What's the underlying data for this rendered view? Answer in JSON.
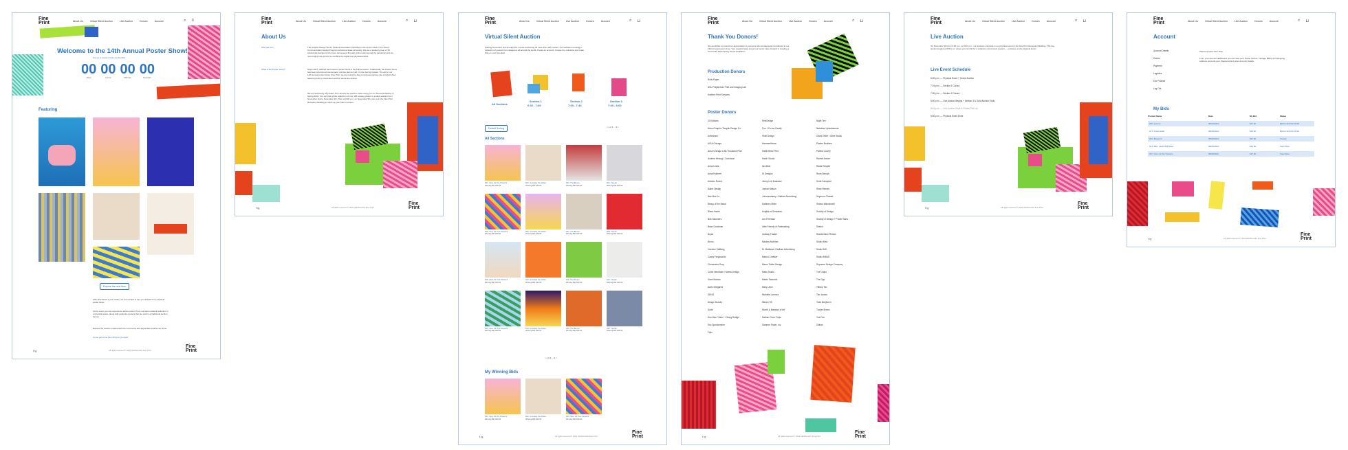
{
  "nav": {
    "logo": "Fine Print",
    "links": [
      "About Us",
      "Virtual Silent Auction",
      "Live Auction",
      "Donors",
      "Account"
    ],
    "search_icon": "search-icon",
    "cart_icon": "cart-icon"
  },
  "home": {
    "title": "Welcome to the 14th Annual Poster Show!",
    "subtitle": "Get up to speed in the Live Auction!",
    "countdown": [
      {
        "n": "00",
        "label": "Days"
      },
      {
        "n": "00",
        "label": "Hours"
      },
      {
        "n": "00",
        "label": "Minutes"
      },
      {
        "n": "00",
        "label": "Seconds"
      }
    ],
    "featuring": "Featuring",
    "explore_btn": "Explore the next item",
    "para1": "After Erie Show a year online, we are excited to see you all back for a physical poster show.",
    "para2": "At the event you can experience all the posters from our talent student collection in a physical space, along with exclusive posters that are sold in a traditional auction format.",
    "para3": "Explore the season curated with the community and appreciate another art show.",
    "cta": "Come get some Fine Print for yourself!"
  },
  "about": {
    "title": "About Us",
    "sidebar": [
      "Who are we?",
      "What is the Poster Show?"
    ],
    "text1": "The Graphic Design Senior Student Association (GDSSA) is the senior class in the Visual Communication Design Program at Arizona State University. We are a student group of 39 passionate designers who have persevered through online learning and the pandemic and are now forging new ground to combine the digital and physical worlds.",
    "text2": "Since 2007, GDSSA has hosted a poster show in the Fall semester. Traditionally, the Poster Show has been a bonus announcement, and we plan to hold it in the Spring instead. The art for our 14th annual poster show, Fine Print, we are trying the best to fold experiences into a hybrid show featuring both a virtual silent auction and a live auction.",
    "text3": "We are auctioning off posters from around the world to raise money for our Senior Exhibition in Spring 2022. You can find all the collection of over 100 unique posters in a silent auction from November 2nd to November 4th. Then at 6:00 p.m. on November 5th, join us in the Fine Print Reception Building to catch up your bids in person.",
    "link": "Fine Print Reception Building"
  },
  "silent": {
    "title": "Virtual Silent Auction",
    "intro": "Starting November 2nd through 4th, we are auctioning off more than 100 posters. Our website is hosting a collection of posters from designers all around the world. Create an account, browse the collection and make bids on your favorites!",
    "sections": [
      {
        "label": "All Sections",
        "time": ""
      },
      {
        "label": "Section 1",
        "time": "6:30 - 7:00"
      },
      {
        "label": "Section 2",
        "time": "7:00 - 7:30"
      },
      {
        "label": "Section 3",
        "time": "7:30 - 8:00"
      }
    ],
    "sort": "Default Sorting",
    "pagination": "< 1 2 3 ... 9 >",
    "all_sections": "All Sections",
    "items": [
      {
        "cap": "001. Give Us Our Flowers",
        "bid": "Winning Bid: $15.00"
      },
      {
        "cap": "002. Consider the Lillies",
        "bid": "Winning Bid: $15.00"
      },
      {
        "cap": "003. The Bonus",
        "bid": "Winning Bid: $15.00"
      },
      {
        "cap": "004. Yamas",
        "bid": "Winning Bid: $15.00"
      },
      {
        "cap": "005. Give Us Your Flowers",
        "bid": "Winning Bid: $15.00"
      },
      {
        "cap": "006. Consider the Lillies",
        "bid": "Winning Bid: $15.00"
      },
      {
        "cap": "007. The Bonus",
        "bid": "Winning Bid: $15.00"
      },
      {
        "cap": "008. Yamas",
        "bid": "Winning Bid: $15.00"
      },
      {
        "cap": "009. Give Us Your Flowers",
        "bid": "Winning Bid: $15.00"
      },
      {
        "cap": "010. Consider the Lillies",
        "bid": "Winning Bid: $15.00"
      },
      {
        "cap": "011. The Bonus",
        "bid": "Winning Bid: $15.00"
      },
      {
        "cap": "012. Yamas",
        "bid": "Winning Bid: $15.00"
      },
      {
        "cap": "013. Give Us Your Flowers",
        "bid": "Winning Bid: $15.00"
      },
      {
        "cap": "014. Consider the Lillies",
        "bid": "Winning Bid: $15.00"
      },
      {
        "cap": "015. The Bonus",
        "bid": "Winning Bid: $15.00"
      },
      {
        "cap": "016. Yamas",
        "bid": "Winning Bid: $15.00"
      }
    ],
    "winning_title": "My Winning Bids",
    "winning": [
      {
        "cap": "001. Give Us Our Flowers",
        "bid": "Winning Bid: $15.00"
      },
      {
        "cap": "002. Consider the Lillies",
        "bid": "Winning Bid: $15.00"
      },
      {
        "cap": "003. Give Us Your Flowers",
        "bid": "Winning Bid: $15.00"
      }
    ]
  },
  "donors": {
    "title": "Thank You Donors!",
    "intro": "We would like to extend our appreciation to everyone who donated and contributed to our 14th annual poster show. Your support helps propel our senior class forward in creating a successful 2022 Spring Senior Exhibition.",
    "production_title": "Production Donors",
    "production": [
      "Rolls Paper",
      "ASU Polytechnic Print and Imaging Lab",
      "Xcellent Print Services"
    ],
    "poster_title": "Poster Donors",
    "col1": [
      "20 Editions",
      "Aaron Draplin / Draplin Design Co.",
      "Adhesions",
      "AIGA Chicago",
      "AIGA Chicago x AB Thousand Plan",
      "Andrew Herzog / Coinvision",
      "Anna Lewis",
      "Anna Hubbert",
      "Antonio Rocha",
      "Baker Design",
      "Bee Mee Jo",
      "Beavy of the Beast",
      "Black Haven",
      "Bob Saunders",
      "Brian Goodman",
      "Bryan",
      "Bruno",
      "Caroline Kallberg",
      "Casey Ferguschild",
      "Chrissindor Drop",
      "Curtis Needham / Needs Design",
      "Dami Marcus",
      "Dave Seriganta",
      "DKNG",
      "Design Donuts",
      "Dude",
      "Don Mac / Sam + Chung Design",
      "Eric Speckemeier",
      "Felix"
    ],
    "col2": [
      "FineDesign",
      "Fun + For an Family",
      "Final Design",
      "Hammerlthrow",
      "Hattie Brew Print",
      "Hatch Studio",
      "Ian Alber",
      "IS Designs",
      "Jenny Lee Illustrator",
      "Jordan Nelson",
      "Juniorsadanny / Nathan Advertising",
      "Kathleen Miller",
      "Knights of Sensation",
      "Lee Freeman",
      "Little Friends of Printmaking",
      "Lindsay Fraster",
      "Mackey Mohrlan",
      "M. Matthews / Nathan Advertising",
      "Marcol Creative",
      "Marco Potter Design",
      "Matin Studio",
      "Martin Saucedo",
      "Mary Lavin",
      "Michelle Lorenza",
      "Miriam Tifl",
      "Month & Mansion of Art",
      "Nathan Cone Prints",
      "Sammer Paper, Inc."
    ],
    "col3": [
      "Night Terr",
      "Nakulbar Upholstereds",
      "Olivia Oliver / Olive Studio",
      "Plaster Brothers",
      "Patrick Curvey",
      "Rachel Archer",
      "Rania Rosplet",
      "Rune Benzyk",
      "Scott Campbell",
      "Sean Reeves",
      "Seymour Chwast",
      "Shawn Wanderdell",
      "Society of Design",
      "Society of Design + Poster Stars",
      "Sketch",
      "Slumbertime Renew",
      "Studio Mira",
      "Studio MD",
      "Studio MBAS",
      "Supreme Design Company",
      "The Outpo",
      "The Opp",
      "Tiffany Tan",
      "Tim Jordan",
      "Todd McQueen",
      "Tucker Brown",
      "Yue Fan",
      "Zhifron"
    ]
  },
  "live": {
    "title": "Live Auction",
    "intro": "On November 5th from 6:30 p.m. to 8:00 p.m., our auctions conclude in our physical event in the Fine Print Reception Building. This live auction begins at 6:00 p.m. where you can bid for a collection of premium posters — exclusive to the physical show!",
    "schedule_title": "Live Event Schedule",
    "schedule": [
      "6:00 p.m. — Physical Event + Check Auction",
      "7:15 p.m. — Section 1 Closes",
      "7:30 p.m. — Section 2 Closes",
      "8:00 p.m. — Live Auction Begins + Section 3 & Gold Auction Ends",
      "8:45 p.m. — Live Auction Ends & Poster Pick Up",
      "9:00 p.m. — Physical Event Ends"
    ]
  },
  "account": {
    "title": "Account",
    "side": [
      "Account Details",
      "Orders",
      "Payment",
      "Logistics",
      "Our Policies",
      "Log Out"
    ],
    "welcome": "Welcome back John Doe!",
    "desc": "From your account dashboard you can view your Poster Orders, manage Billing and Shipping Address, and edit your Password and other Account Details.",
    "bids_title": "My Bids",
    "headers": [
      "Product Name",
      "Date",
      "My Bid",
      "Status"
    ],
    "rows": [
      [
        "005. Quorus",
        "08/26/2022",
        "$17.00",
        "$(bid is $15.00 15:00"
      ],
      [
        "017. Dress Edith",
        "08/26/2022",
        "$13.00",
        "$(bid is $15.00 15:00"
      ],
      [
        "022. Blueprint",
        "08/26/2022",
        "$27.00",
        "Closed"
      ],
      [
        "041. Barn Yards Will Rave",
        "08/26/2022",
        "$12.00",
        "View More"
      ],
      [
        "097. Give Us Our Flowers",
        "08/26/2022",
        "$17.00",
        "View More"
      ]
    ]
  },
  "footer": {
    "copyright": "All rights reserved © 2022 GDSSA ASU Fine Print",
    "logo": "Fine Print",
    "social": "f ig"
  }
}
